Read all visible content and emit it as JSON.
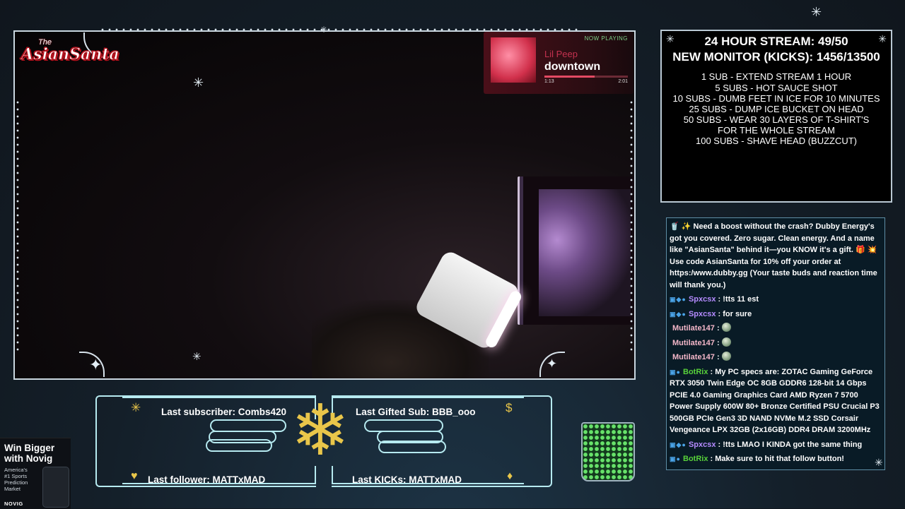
{
  "logo": {
    "the": "The",
    "name": "AsianSanta"
  },
  "now_playing": {
    "tag": "NOW PLAYING",
    "artist": "Lil Peep",
    "title": "downtown",
    "elapsed": "1:13",
    "total": "2:01",
    "progress": 0.6
  },
  "goals": {
    "stream": "24 HOUR STREAM: 49/50",
    "monitor": "NEW MONITOR (KICKS): 1456/13500",
    "items": [
      "1 SUB - EXTEND STREAM 1 HOUR",
      "5 SUBS - HOT SAUCE SHOT",
      "10 SUBS - DUMB FEET IN ICE FOR 10 MINUTES",
      "25 SUBS - DUMP ICE BUCKET ON HEAD",
      "50 SUBS - WEAR 30 LAYERS OF T-SHIRT'S",
      "FOR THE WHOLE STREAM",
      "100 SUBS - SHAVE HEAD (BUZZCUT)"
    ]
  },
  "chat": {
    "promo": "🥤 ✨ Need a boost without the crash? Dubby Energy's got you covered. Zero sugar. Clean energy. And a name like \"AsianSanta\" behind it—you KNOW it's a gift. 🎁 💥 Use code AsianSanta for 10% off your order at https:/www.dubby.gg (Your taste buds and reaction time will thank you.)",
    "messages": [
      {
        "user": "Spxcsx",
        "text": "!tts 11 est"
      },
      {
        "user": "Spxcsx",
        "text": "for sure"
      },
      {
        "user": "Mutilate147",
        "text": ""
      },
      {
        "user": "Mutilate147",
        "text": ""
      },
      {
        "user": "Mutilate147",
        "text": ""
      },
      {
        "user": "BotRix",
        "text": "My PC specs are: ZOTAC Gaming GeForce RTX 3050 Twin Edge OC 8GB GDDR6 128-bit 14 Gbps PCIE 4.0 Gaming Graphics Card AMD Ryzen 7 5700 Power Supply 600W 80+ Bronze Certified PSU Crucial P3 500GB PCIe Gen3 3D NAND NVMe M.2 SSD Corsair Vengeance LPX 32GB (2x16GB) DDR4 DRAM 3200MHz"
      },
      {
        "user": "Spxcsx",
        "text": "!tts LMAO I KINDA got the same thing"
      },
      {
        "user": "BotRix",
        "text": "Make sure to hit that follow button!"
      }
    ]
  },
  "alerts": {
    "last_subscriber": "Last subscriber: Combs420",
    "last_gifted": "Last Gifted Sub: BBB_ooo",
    "last_follower": "Last follower: MATTxMAD",
    "last_kicks": "Last KICKs: MATTxMAD"
  },
  "ad": {
    "headline_1": "Win Bigger",
    "headline_2": "with Novig",
    "sub_1": "America's",
    "sub_2": "#1 Sports",
    "sub_3": "Prediction",
    "sub_4": "Market",
    "brand": "NOVIG"
  },
  "colors": {
    "accent": "#b6eaf0",
    "gold": "#e9c64a",
    "chat_bg": "#091b26",
    "np_red": "#c4324f"
  }
}
